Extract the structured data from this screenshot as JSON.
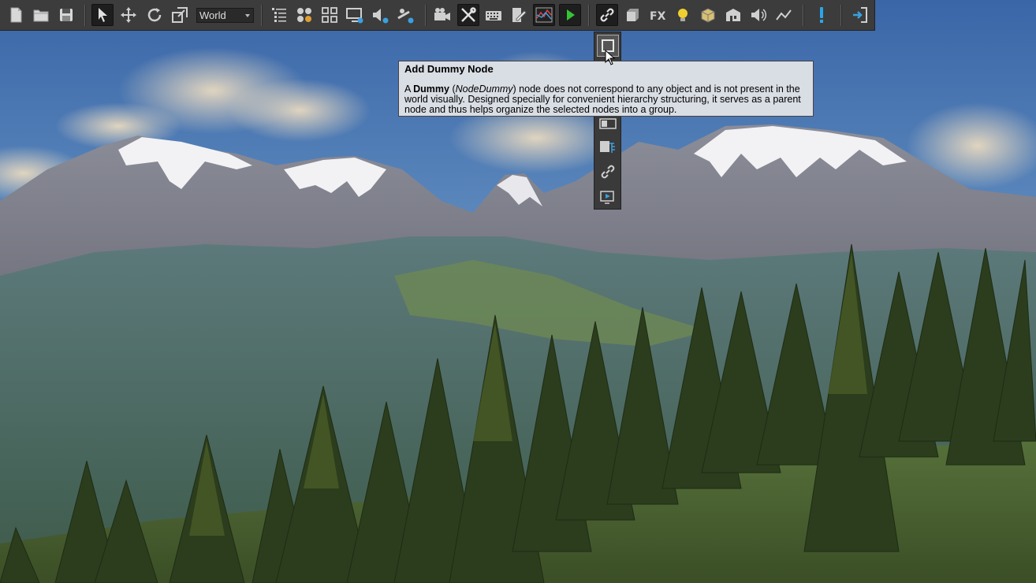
{
  "toolbar": {
    "coordinate_space": "World",
    "buttons": [
      {
        "name": "new-file-icon"
      },
      {
        "name": "open-folder-icon"
      },
      {
        "name": "save-icon"
      },
      {
        "name": "select-arrow-icon"
      },
      {
        "name": "move-icon"
      },
      {
        "name": "rotate-icon"
      },
      {
        "name": "scale-icon"
      },
      {
        "name": "node-list-icon"
      },
      {
        "name": "materials-icon"
      },
      {
        "name": "properties-grid-icon"
      },
      {
        "name": "render-settings-icon"
      },
      {
        "name": "sound-settings-icon"
      },
      {
        "name": "physics-settings-icon"
      },
      {
        "name": "camera-icon"
      },
      {
        "name": "tools-icon"
      },
      {
        "name": "keyboard-icon"
      },
      {
        "name": "editor-icon"
      },
      {
        "name": "profiler-graph-icon"
      },
      {
        "name": "play-icon"
      },
      {
        "name": "link-icon"
      },
      {
        "name": "box-icon"
      },
      {
        "name": "fx-icon"
      },
      {
        "name": "light-bulb-icon"
      },
      {
        "name": "decal-icon"
      },
      {
        "name": "world-building-icon"
      },
      {
        "name": "sound-source-icon"
      },
      {
        "name": "path-icon"
      },
      {
        "name": "warning-exclamation-icon"
      },
      {
        "name": "exit-icon"
      }
    ]
  },
  "dropdown": {
    "items": [
      {
        "name": "dummy-node-icon"
      },
      {
        "name": "layer-node-icon"
      },
      {
        "name": "pivot-node-icon"
      },
      {
        "name": "trigger-node-icon"
      },
      {
        "name": "screen-node-icon"
      },
      {
        "name": "reference-node-icon"
      },
      {
        "name": "link-node-icon"
      },
      {
        "name": "player-node-icon"
      }
    ]
  },
  "tooltip": {
    "title": "Add Dummy Node",
    "body_prefix": "A ",
    "body_bold": "Dummy",
    "body_paren_open": " (",
    "body_italic": "NodeDummy",
    "body_rest": ") node does not correspond to any object and is not present in the world visually. Designed specially for convenient hierarchy structuring, it serves as a parent node and thus helps organize the selected nodes into a group."
  },
  "colors": {
    "toolbar_bg": "#3c3c3c",
    "tooltip_bg": "#d9dde4",
    "play_green": "#35c435",
    "warning_blue": "#2aa6e8",
    "bulb_yellow": "#f0d030"
  }
}
